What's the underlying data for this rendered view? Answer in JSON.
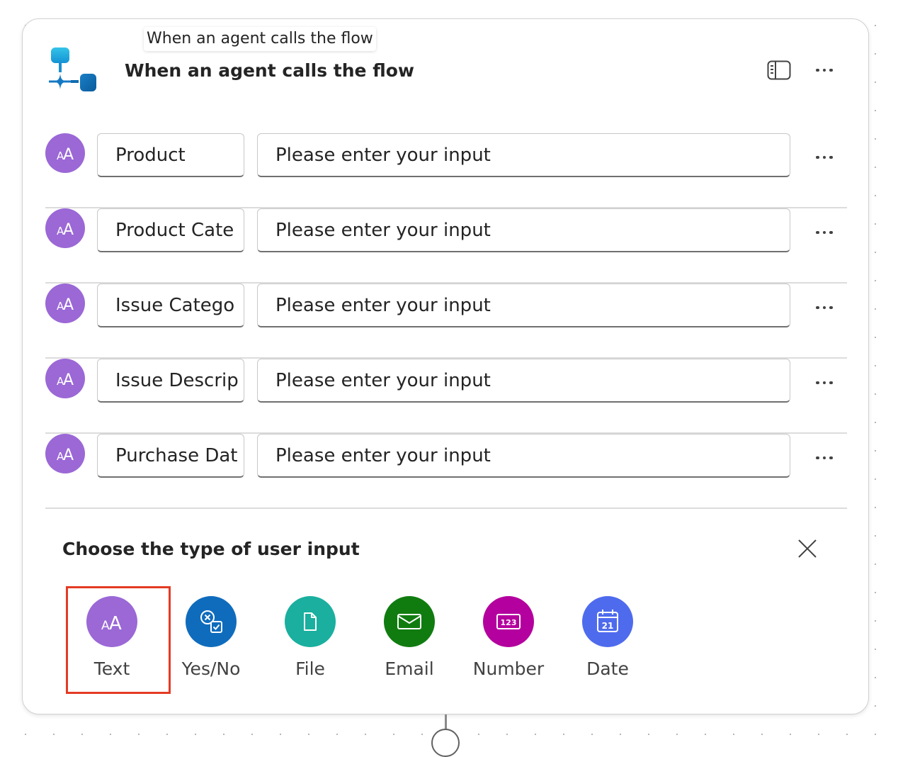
{
  "tooltip": "When an agent calls the flow",
  "trigger": {
    "title": "When an agent calls the flow",
    "icon": "flow-trigger-icon",
    "panel_icon": "side-panel-icon",
    "more_icon": "more-options-icon"
  },
  "inputs": [
    {
      "name": "Product",
      "placeholder": "Please enter your input",
      "type_icon": "text-type-icon"
    },
    {
      "name": "Product Cate",
      "placeholder": "Please enter your input",
      "type_icon": "text-type-icon"
    },
    {
      "name": "Issue Catego",
      "placeholder": "Please enter your input",
      "type_icon": "text-type-icon"
    },
    {
      "name": "Issue Descrip",
      "placeholder": "Please enter your input",
      "type_icon": "text-type-icon"
    },
    {
      "name": "Purchase Dat",
      "placeholder": "Please enter your input",
      "type_icon": "text-type-icon"
    }
  ],
  "chooser": {
    "title": "Choose the type of user input",
    "close_icon": "close-icon",
    "selected": "Text",
    "types": [
      {
        "label": "Text",
        "icon": "text-icon",
        "color": "#9b68d6"
      },
      {
        "label": "Yes/No",
        "icon": "yes-no-icon",
        "color": "#0f6cbd"
      },
      {
        "label": "File",
        "icon": "file-icon",
        "color": "#1aaf9e"
      },
      {
        "label": "Email",
        "icon": "email-icon",
        "color": "#107c10"
      },
      {
        "label": "Number",
        "icon": "number-icon",
        "color": "#b4009e"
      },
      {
        "label": "Date",
        "icon": "calendar-icon",
        "color": "#4f6bed"
      }
    ]
  },
  "colors": {
    "highlight": "#e43b24",
    "text_type_avatar": "#9b68d6"
  }
}
